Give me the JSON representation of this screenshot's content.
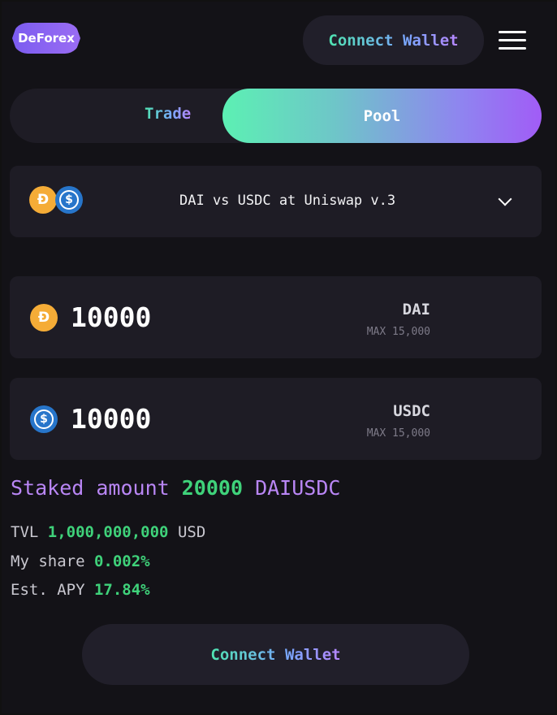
{
  "header": {
    "logo_text": "DeForex",
    "connect_label_1": "Connect",
    "connect_label_2": "Wallet"
  },
  "tabs": [
    {
      "label": "Trade",
      "active": false
    },
    {
      "label": "Pool",
      "active": true
    }
  ],
  "pair": {
    "label": "DAI vs USDC at Uniswap v.3",
    "icons": [
      "dai-icon",
      "usdc-icon"
    ]
  },
  "inputs": [
    {
      "value": "10000",
      "token": "DAI",
      "max": "MAX 15,000",
      "icon": "dai-icon"
    },
    {
      "value": "10000",
      "token": "USDC",
      "max": "MAX 15,000",
      "icon": "usdc-icon"
    }
  ],
  "staked": {
    "prefix": "Staked amount",
    "amount": "20000",
    "token": "DAIUSDC"
  },
  "stats": [
    {
      "label": "TVL",
      "value": "1,000,000,000",
      "suffix": "USD"
    },
    {
      "label": "My share",
      "value": "0.002%",
      "suffix": ""
    },
    {
      "label": "Est. APY",
      "value": "17.84%",
      "suffix": ""
    }
  ],
  "footer": {
    "connect_label_1": "Connect",
    "connect_label_2": "Wallet"
  },
  "colors": {
    "background": "#131217",
    "card": "#1e1c25",
    "accent_purple": "#b986f5",
    "accent_green": "#3fd27a",
    "dai": "#f5ac37",
    "usdc": "#2775ca"
  }
}
